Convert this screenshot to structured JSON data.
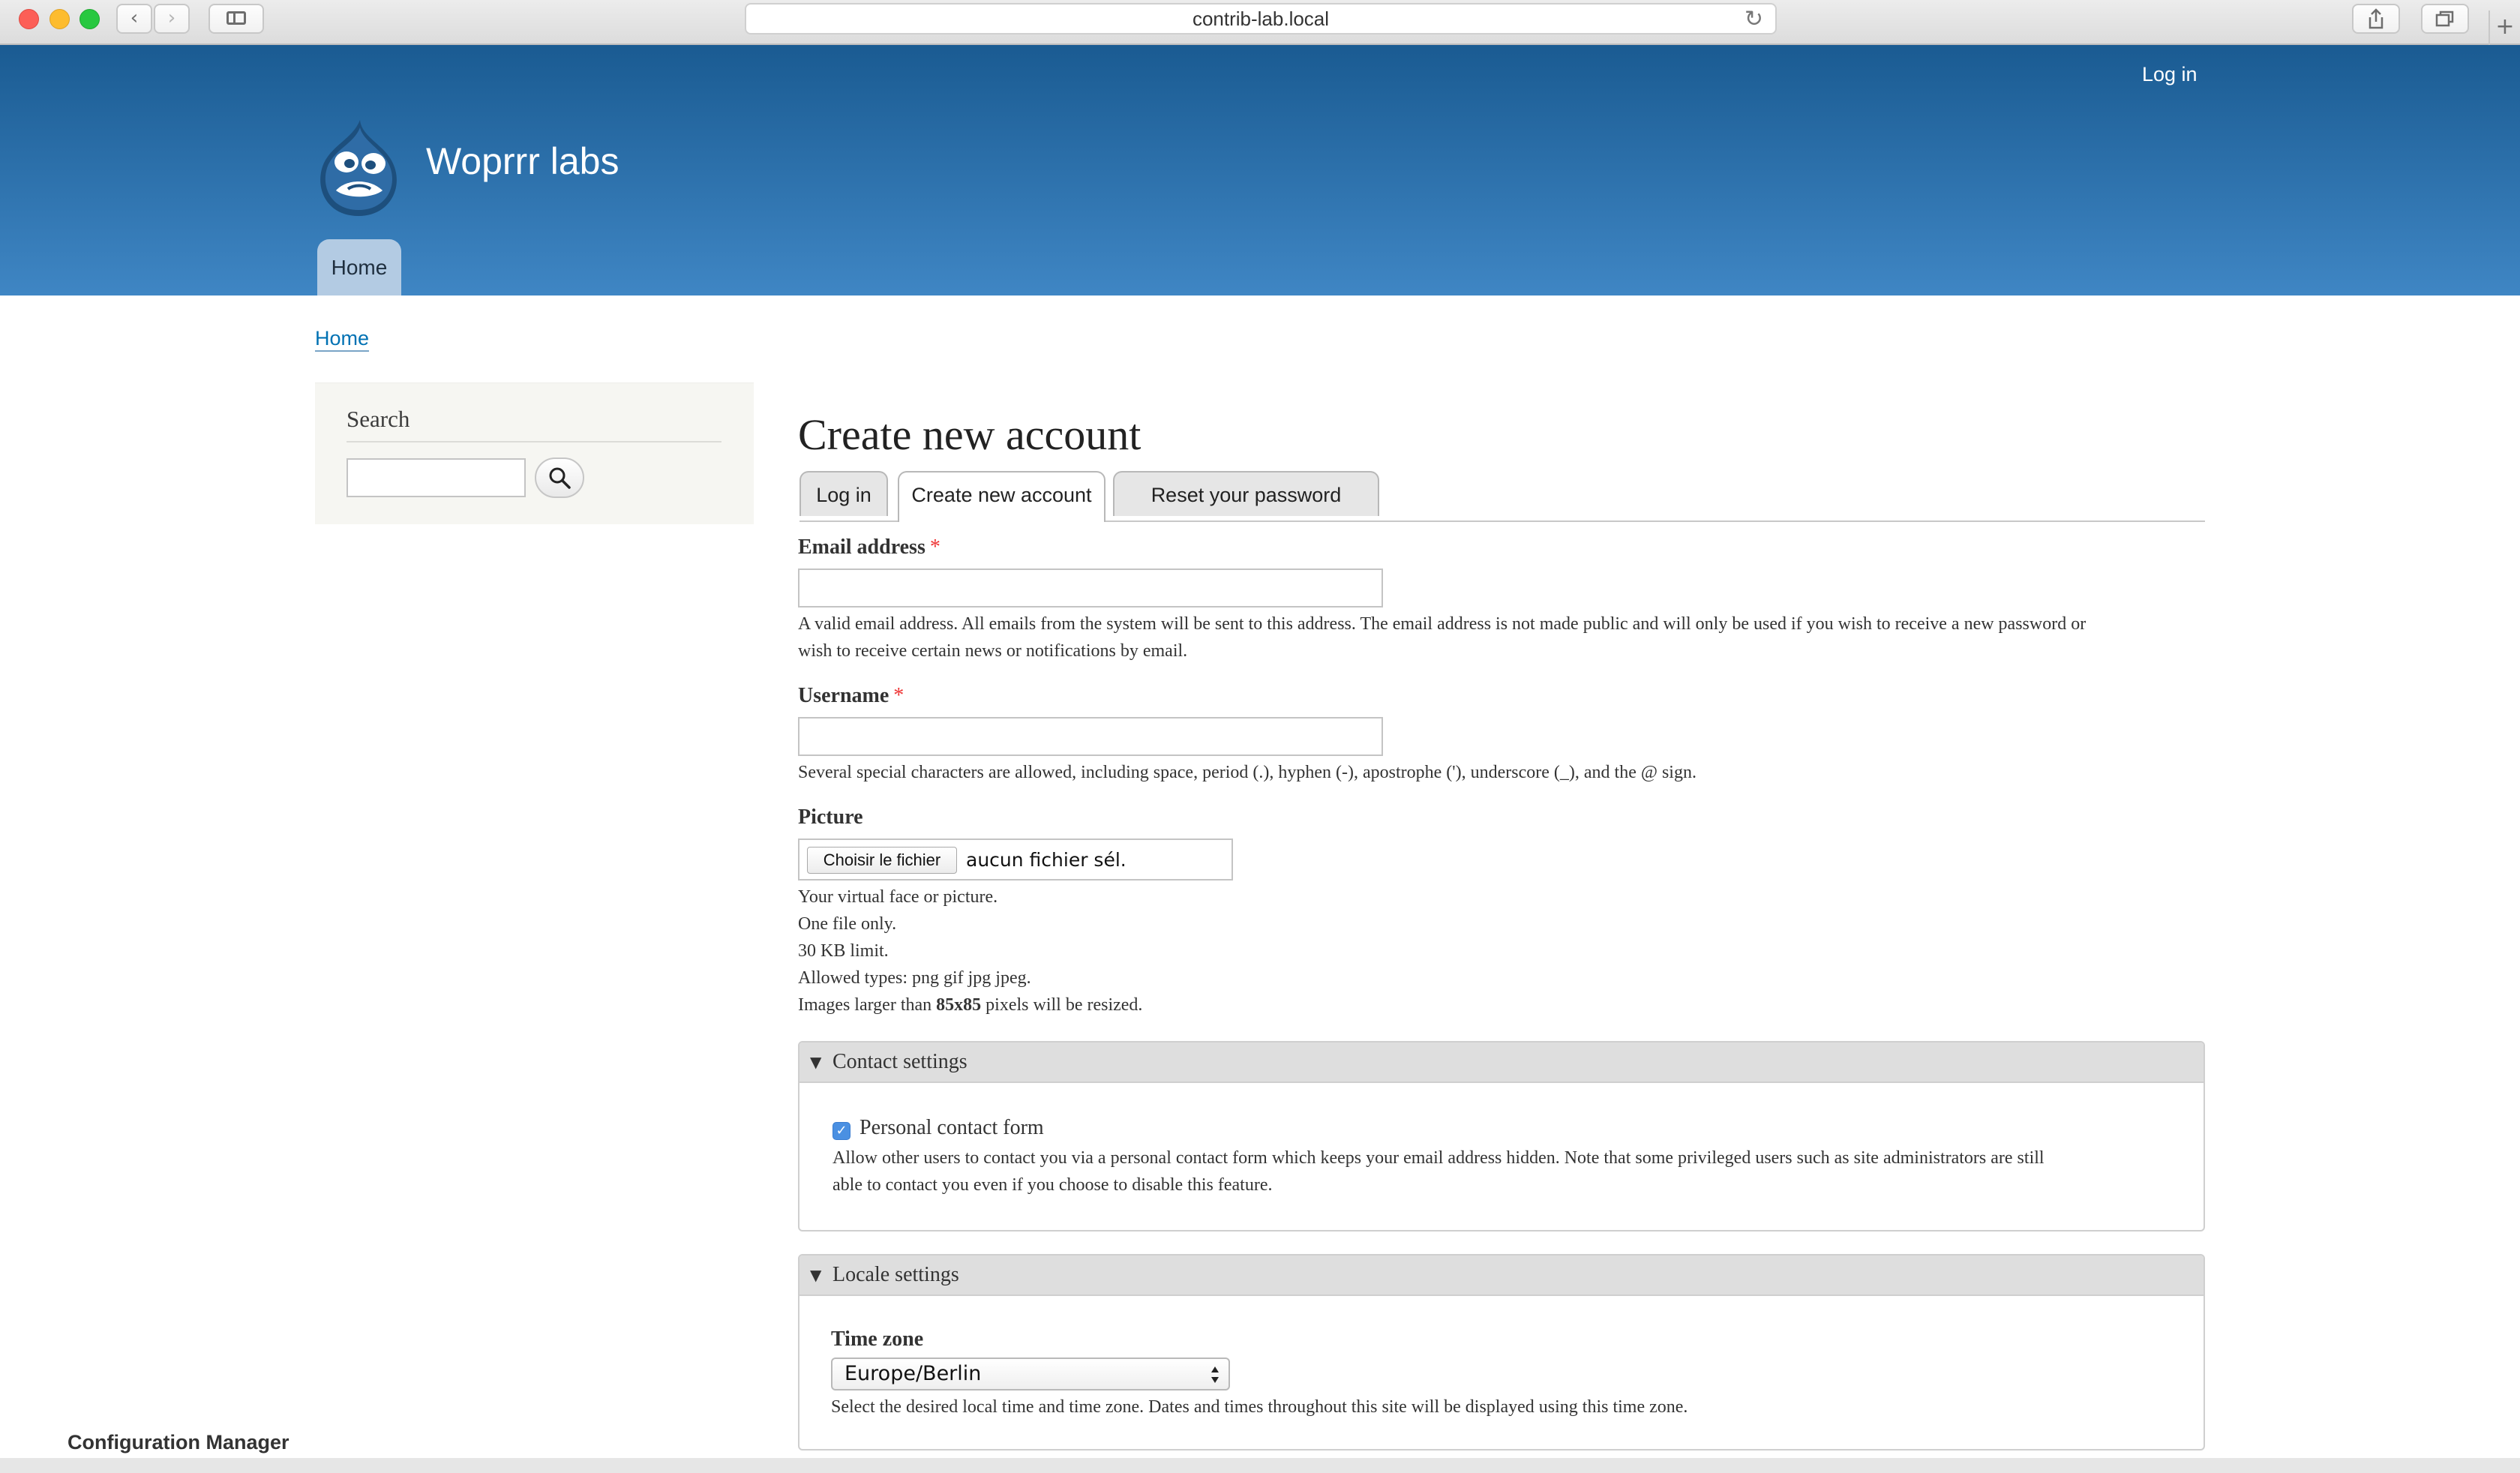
{
  "browser": {
    "url": "contrib-lab.local",
    "icons": {
      "back": "chevron-left-icon",
      "forward": "chevron-right-icon",
      "sidebar": "sidebar-icon",
      "reload": "reload-icon",
      "share": "share-icon",
      "tabs": "tabs-overview-icon",
      "new_tab": "plus-icon"
    }
  },
  "header": {
    "login_link": "Log in",
    "site_name": "Woprrr labs",
    "nav": {
      "home": "Home"
    }
  },
  "breadcrumb": {
    "home": "Home"
  },
  "sidebar": {
    "search": {
      "title": "Search",
      "value": "",
      "button_icon": "search-icon"
    }
  },
  "main": {
    "title": "Create new account",
    "tabs": [
      {
        "label": "Log in",
        "active": false
      },
      {
        "label": "Create new account",
        "active": true
      },
      {
        "label": "Reset your password",
        "active": false
      }
    ],
    "email": {
      "label": "Email address",
      "required_marker": "*",
      "value": "",
      "description_line1": "A valid email address. All emails from the system will be sent to this address. The email address is not made public and will only be used if you wish to receive a new password or",
      "description_line2": "wish to receive certain news or notifications by email."
    },
    "username": {
      "label": "Username",
      "required_marker": "*",
      "value": "",
      "description": "Several special characters are allowed, including space, period (.), hyphen (-), apostrophe ('), underscore (_), and the @ sign."
    },
    "picture": {
      "label": "Picture",
      "button_label": "Choisir le fichier",
      "status": "aucun fichier sél.",
      "help_lines": [
        "Your virtual face or picture.",
        "One file only.",
        "30 KB limit.",
        "Allowed types: png gif jpg jpeg."
      ],
      "resize_prefix": "Images larger than",
      "resize_dimensions": "85x85",
      "resize_suffix": "pixels will be resized."
    },
    "contact_settings": {
      "legend": "Contact settings",
      "checkbox_label": "Personal contact form",
      "checked": true,
      "description_line1": "Allow other users to contact you via a personal contact form which keeps your email address hidden. Note that some privileged users such as site administrators are still",
      "description_line2": "able to contact you even if you choose to disable this feature."
    },
    "locale_settings": {
      "legend": "Locale settings",
      "timezone_label": "Time zone",
      "timezone_value": "Europe/Berlin",
      "timezone_description": "Select the desired local time and time zone. Dates and times throughout this site will be displayed using this time zone."
    }
  },
  "footer_peek": "Configuration Manager",
  "colors": {
    "header_top": "#1a5b92",
    "header_bottom": "#3f86c4",
    "link": "#0071b3",
    "required": "#ee3333",
    "checkbox": "#4a90e2"
  }
}
